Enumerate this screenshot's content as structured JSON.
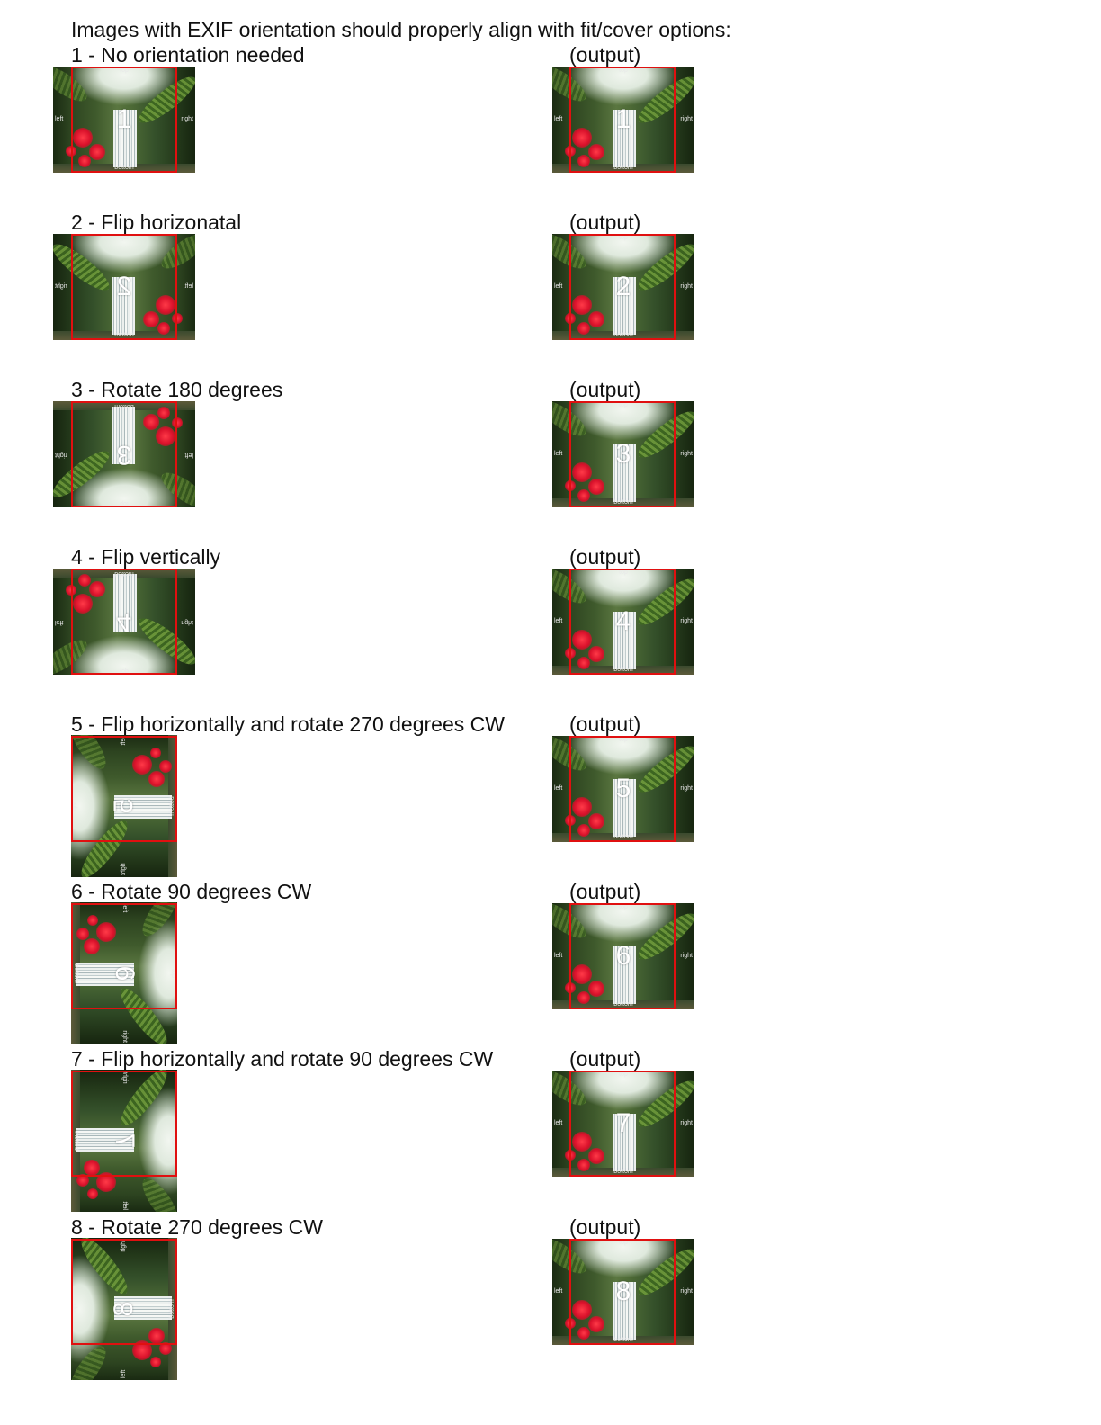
{
  "heading": "Images with EXIF orientation should properly align with fit/cover options:",
  "output_label": "(output)",
  "photo_tags": {
    "left": "left",
    "right": "right",
    "top": "top",
    "bottom": "bottom"
  },
  "cases": [
    {
      "number": "1",
      "label": "1 - No orientation needed"
    },
    {
      "number": "2",
      "label": "2 - Flip horizonatal"
    },
    {
      "number": "3",
      "label": "3 - Rotate 180 degrees"
    },
    {
      "number": "4",
      "label": "4 - Flip vertically"
    },
    {
      "number": "5",
      "label": "5 - Flip horizontally and rotate 270 degrees CW"
    },
    {
      "number": "6",
      "label": "6 - Rotate 90 degrees CW"
    },
    {
      "number": "7",
      "label": "7 - Flip horizontally and rotate 90 degrees CW"
    },
    {
      "number": "8",
      "label": "8 - Rotate 270 degrees CW"
    }
  ],
  "colors": {
    "frame": "#e01010",
    "text": "#111111",
    "background": "#ffffff"
  }
}
